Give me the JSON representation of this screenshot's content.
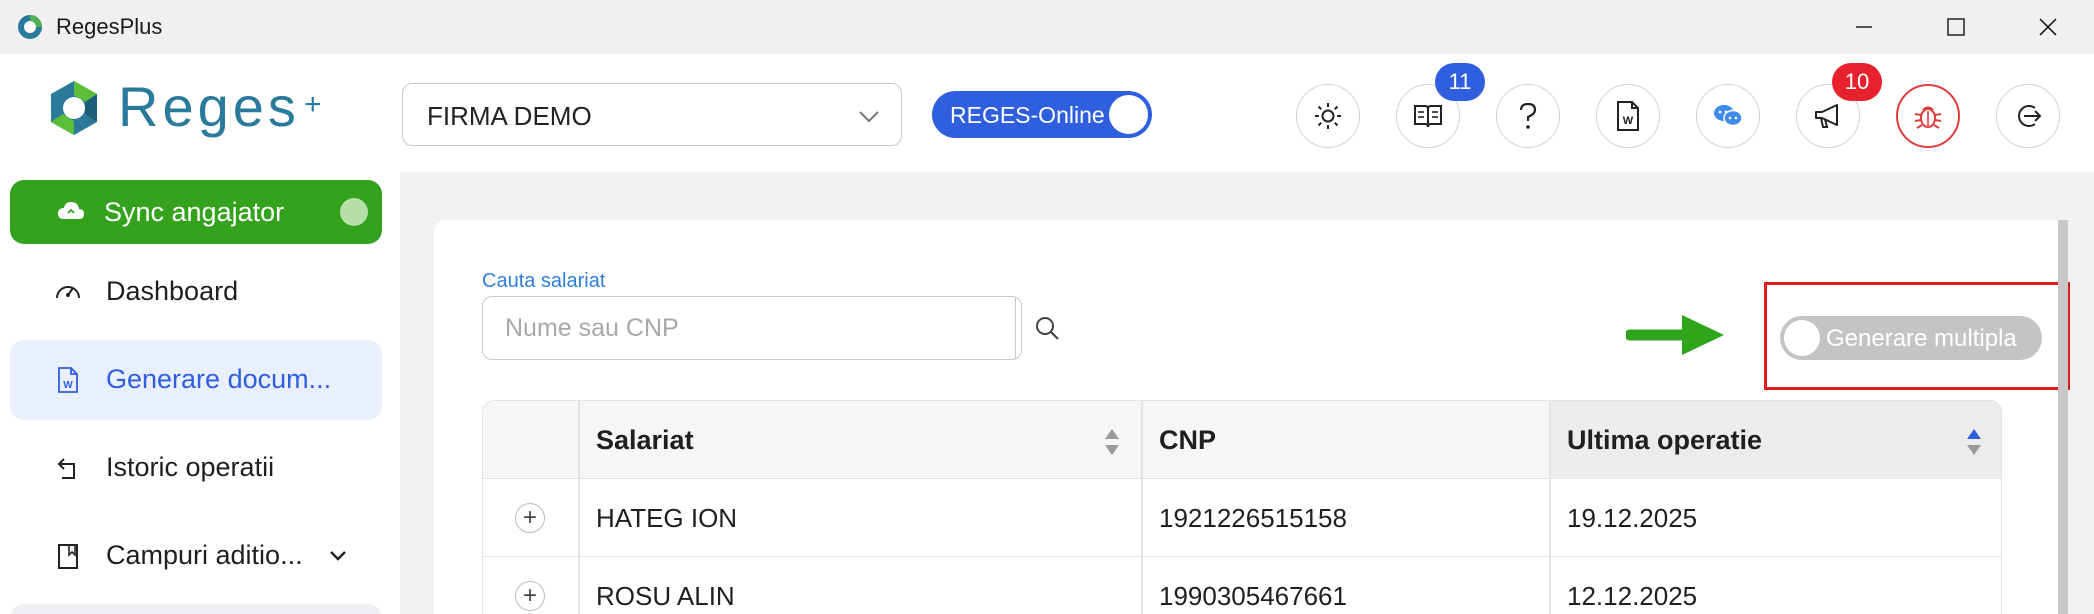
{
  "window": {
    "title": "RegesPlus"
  },
  "header": {
    "logo_text": "Reges",
    "logo_plus": "+",
    "company": {
      "value": "FIRMA DEMO"
    },
    "reges_toggle": {
      "label": "REGES-Online",
      "on": true
    },
    "icons": [
      {
        "name": "theme-sun-icon"
      },
      {
        "name": "book-icon",
        "badge": "11",
        "badge_color": "#2f5fde"
      },
      {
        "name": "help-icon"
      },
      {
        "name": "word-doc-icon"
      },
      {
        "name": "chat-icon"
      },
      {
        "name": "megaphone-icon",
        "badge": "10",
        "badge_color": "#e8222c"
      },
      {
        "name": "bug-icon",
        "accent": "#e23b3b"
      },
      {
        "name": "logout-icon"
      }
    ]
  },
  "sidebar": {
    "sync": {
      "label": "Sync angajator",
      "color": "#34a21c"
    },
    "items": [
      {
        "label": "Dashboard",
        "icon": "gauge-icon"
      },
      {
        "label": "Generare docum...",
        "icon": "word-doc-icon",
        "active": true
      },
      {
        "label": "Istoric operatii",
        "icon": "history-icon"
      },
      {
        "label": "Campuri aditio...",
        "icon": "bookmark-icon",
        "has_submenu": true
      }
    ]
  },
  "main": {
    "search": {
      "label": "Cauta salariat",
      "placeholder": "Nume sau CNP",
      "value": ""
    },
    "multi_toggle": {
      "label": "Generare multipla",
      "on": false
    },
    "table": {
      "columns": [
        "Salariat",
        "CNP",
        "Ultima operatie"
      ],
      "sorted_column": "Ultima operatie",
      "rows": [
        {
          "expand": "+",
          "salariat": "HATEG ION",
          "cnp": "1921226515158",
          "ultima_operatie": "19.12.2025"
        },
        {
          "expand": "+",
          "salariat": "ROSU ALIN",
          "cnp": "1990305467661",
          "ultima_operatie": "12.12.2025"
        }
      ]
    }
  }
}
